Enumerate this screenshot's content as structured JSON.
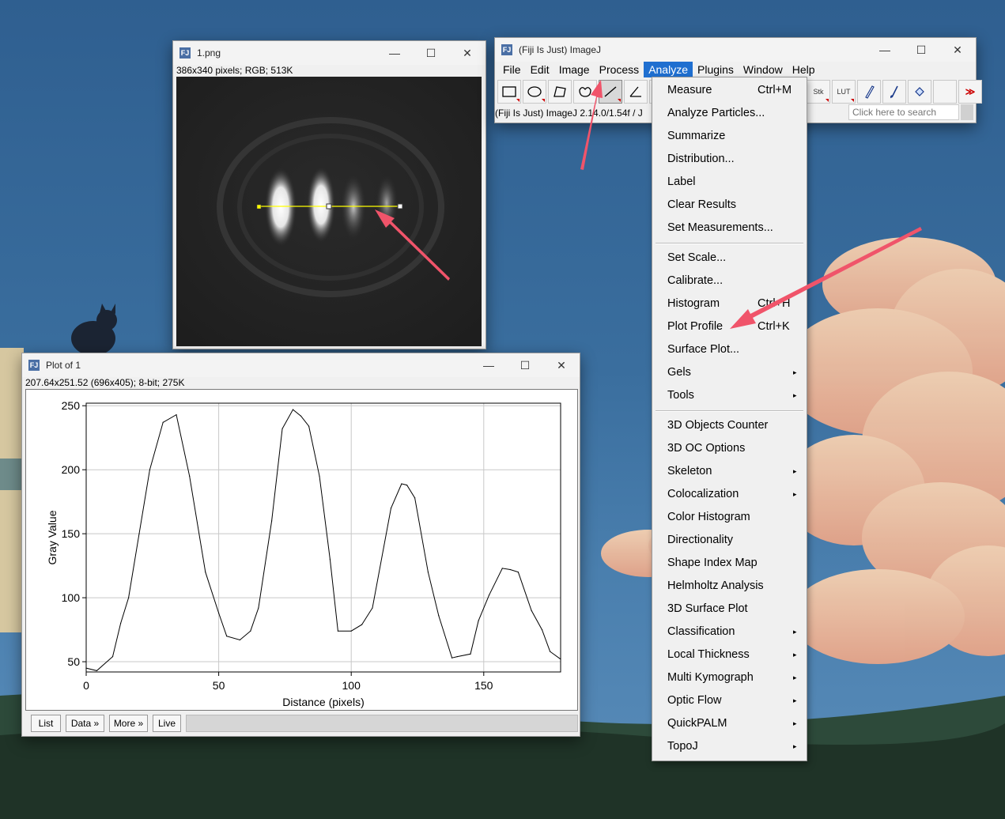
{
  "desktop": {
    "description_colors": {
      "sky": "#3a6e9e",
      "cloud": "#f2c6a2",
      "grass": "#243a2c"
    }
  },
  "image_window": {
    "title": "1.png",
    "info": "386x340 pixels; RGB; 513K",
    "min": "—",
    "max": "☐",
    "close": "✕"
  },
  "imagej_window": {
    "title": "(Fiji Is Just) ImageJ",
    "menus": [
      "File",
      "Edit",
      "Image",
      "Process",
      "Analyze",
      "Plugins",
      "Window",
      "Help"
    ],
    "active_menu": "Analyze",
    "status_text": "(Fiji Is Just) ImageJ 2.14.0/1.54f / J",
    "search_placeholder": "Click here to search",
    "tools": [
      "rectangle-tool",
      "oval-tool",
      "polygon-tool",
      "freehand-tool",
      "line-tool",
      "angle-tool",
      "point-tool"
    ],
    "right_tools": {
      "stk": "Stk",
      "lut": "LUT",
      "more": "≫"
    },
    "min": "—",
    "max": "☐",
    "close": "✕"
  },
  "analyze_menu": {
    "items": [
      {
        "label": "Measure",
        "shortcut": "Ctrl+M"
      },
      {
        "label": "Analyze Particles..."
      },
      {
        "label": "Summarize"
      },
      {
        "label": "Distribution..."
      },
      {
        "label": "Label"
      },
      {
        "label": "Clear Results"
      },
      {
        "label": "Set Measurements..."
      },
      {
        "sep": true
      },
      {
        "label": "Set Scale..."
      },
      {
        "label": "Calibrate..."
      },
      {
        "label": "Histogram",
        "shortcut": "Ctrl+H"
      },
      {
        "label": "Plot Profile",
        "shortcut": "Ctrl+K"
      },
      {
        "label": "Surface Plot..."
      },
      {
        "label": "Gels",
        "submenu": true
      },
      {
        "label": "Tools",
        "submenu": true
      },
      {
        "sep": true
      },
      {
        "label": "3D Objects Counter"
      },
      {
        "label": "3D OC Options"
      },
      {
        "label": "Skeleton",
        "submenu": true
      },
      {
        "label": "Colocalization",
        "submenu": true
      },
      {
        "label": "Color Histogram"
      },
      {
        "label": "Directionality"
      },
      {
        "label": "Shape Index Map"
      },
      {
        "label": "Helmholtz Analysis"
      },
      {
        "label": "3D Surface Plot"
      },
      {
        "label": "Classification",
        "submenu": true
      },
      {
        "label": "Local Thickness",
        "submenu": true
      },
      {
        "label": "Multi Kymograph",
        "submenu": true
      },
      {
        "label": "Optic Flow",
        "submenu": true
      },
      {
        "label": "QuickPALM",
        "submenu": true
      },
      {
        "label": "TopoJ",
        "submenu": true
      }
    ],
    "submenu_arrow": "▸"
  },
  "plot_window": {
    "title": "Plot of 1",
    "info": "207.64x251.52   (696x405); 8-bit; 275K",
    "buttons": {
      "list": "List",
      "data": "Data »",
      "more": "More »",
      "live": "Live"
    },
    "min": "—",
    "max": "☐",
    "close": "✕"
  },
  "chart_data": {
    "type": "line",
    "title": "",
    "xlabel": "Distance (pixels)",
    "ylabel": "Gray Value",
    "xlim": [
      0,
      179
    ],
    "ylim": [
      42,
      252
    ],
    "x_ticks": [
      0,
      50,
      100,
      150
    ],
    "y_ticks": [
      50,
      100,
      150,
      200,
      250
    ],
    "grid": true,
    "series": [
      {
        "x": [
          0,
          4,
          10,
          13,
          16,
          20,
          24,
          29,
          34,
          39,
          45,
          50,
          53,
          58,
          62,
          65,
          70,
          74,
          78,
          81,
          84,
          88,
          92,
          95,
          100,
          104,
          108,
          115,
          119,
          121,
          124,
          129,
          133,
          138,
          140,
          145,
          148,
          152,
          157,
          160,
          163,
          168,
          172,
          175,
          179
        ],
        "values": [
          45,
          43,
          54,
          80,
          100,
          150,
          200,
          237,
          243,
          195,
          120,
          88,
          70,
          67,
          74,
          92,
          160,
          232,
          247,
          242,
          234,
          195,
          130,
          74,
          74,
          79,
          92,
          170,
          189,
          188,
          178,
          120,
          86,
          53,
          54,
          56,
          82,
          102,
          123,
          122,
          120,
          90,
          75,
          58,
          52
        ]
      }
    ]
  }
}
